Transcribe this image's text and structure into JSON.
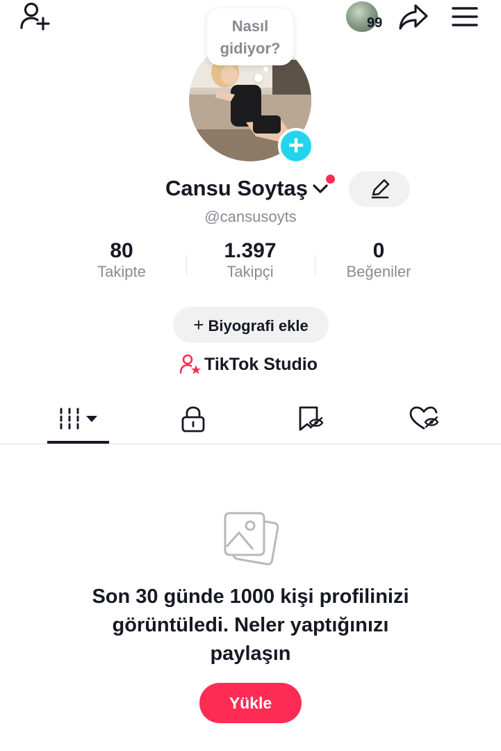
{
  "top_bar": {
    "story_count": "99"
  },
  "status_bubble": {
    "text": "Nasıl\ngidiyor?"
  },
  "profile": {
    "display_name": "Cansu Soytaş",
    "username": "@cansusoyts"
  },
  "stats": [
    {
      "value": "80",
      "label": "Takipte"
    },
    {
      "value": "1.397",
      "label": "Takipçi"
    },
    {
      "value": "0",
      "label": "Beğeniler"
    }
  ],
  "actions": {
    "bio_plus": "+",
    "bio_label": "Biyografi ekle",
    "studio_label": "TikTok Studio"
  },
  "tabs": [
    {
      "name": "videos-grid",
      "icon": "grid-bars-icon",
      "selected": true
    },
    {
      "name": "private",
      "icon": "lock-icon",
      "selected": false
    },
    {
      "name": "saved",
      "icon": "bookmark-hidden-icon",
      "selected": false
    },
    {
      "name": "liked",
      "icon": "heart-hidden-icon",
      "selected": false
    }
  ],
  "empty_state": {
    "message": "Son 30 günde 1000 kişi profilinizi görüntüledi. Neler yaptığınızı paylaşın",
    "upload_label": "Yükle"
  },
  "colors": {
    "accent": "#fe2c55",
    "avatar_add": "#20d5ec",
    "muted_text": "#8a8b91"
  }
}
